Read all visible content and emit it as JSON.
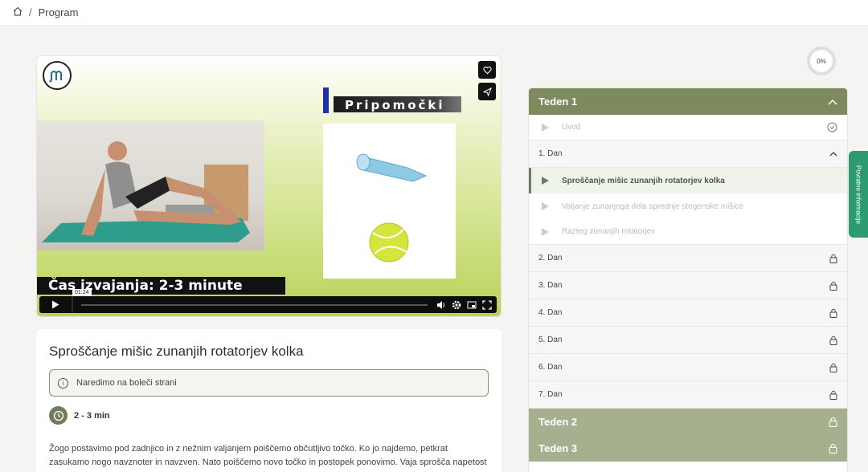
{
  "breadcrumb": {
    "current": "Program"
  },
  "video": {
    "section_title": "Pripomočki",
    "caption": "Čas izvajanja: 2-3 minute",
    "time": "01:24",
    "progress": 0.0
  },
  "content": {
    "title": "Sproščanje mišic zunanjih rotatorjev kolka",
    "note": "Naredimo na boleči strani",
    "duration": "2 - 3 min",
    "description": "Žogo postavimo pod zadnjico in z nežnim valjanjem poiščemo občutljivo točko. Ko jo najdemo, petkrat zasukamo nogo navznoter in navzven. Nato poiščemo novo točko in postopek ponovimo. Vaja sprošča napetost v zadnjičnih mišicah."
  },
  "progress": {
    "label": "0%"
  },
  "sidebar": {
    "weeks": [
      {
        "label": "Teden 1"
      },
      {
        "label": "Teden 2"
      },
      {
        "label": "Teden 3"
      }
    ],
    "intro": "Uvod",
    "days": [
      {
        "label": "1. Dan"
      },
      {
        "label": "2. Dan"
      },
      {
        "label": "3. Dan"
      },
      {
        "label": "4. Dan"
      },
      {
        "label": "5. Dan"
      },
      {
        "label": "6. Dan"
      },
      {
        "label": "7. Dan"
      }
    ],
    "lessons": [
      {
        "label": "Sproščanje mišic zunanjih rotatorjev kolka"
      },
      {
        "label": "Valjanje zunanjega dela sprednje stegenske mišice"
      },
      {
        "label": "Razteg zunanjih rotatorjev"
      }
    ]
  },
  "feedback": {
    "label": "Povratne informacije"
  },
  "colors": {
    "accent": "#7c8a5e",
    "muted": "#a6b08f",
    "feedback": "#2e9a72"
  }
}
